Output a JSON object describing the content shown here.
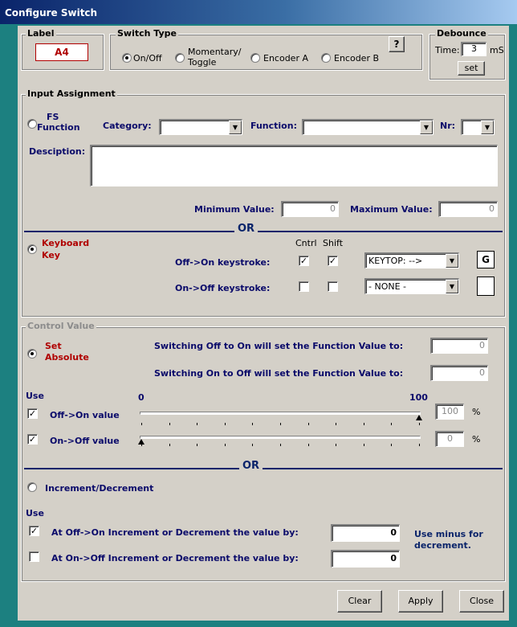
{
  "window": {
    "title": "Configure Switch"
  },
  "label_group": {
    "legend": "Label",
    "value": "A4"
  },
  "switch_type": {
    "legend": "Switch Type",
    "options": [
      "On/Off",
      "Momentary/",
      "Toggle",
      "Encoder A",
      "Encoder B"
    ],
    "selected": "On/Off",
    "help_label": "?"
  },
  "debounce": {
    "legend": "Debounce",
    "time_label": "Time:",
    "value": "3",
    "unit": "mS",
    "set_label": "set"
  },
  "input_assignment": {
    "legend": "Input Assignment",
    "fs_function_label_1": "FS",
    "fs_function_label_2": "Function",
    "category_label": "Category:",
    "category_value": "",
    "function_label": "Function:",
    "function_value": "",
    "nr_label": "Nr:",
    "nr_value": "",
    "description_label": "Desciption:",
    "description_value": "",
    "min_label": "Minimum Value:",
    "min_value": "0",
    "max_label": "Maximum Value:",
    "max_value": "0",
    "or_label": "OR",
    "keyboard_label_1": "Keyboard",
    "keyboard_label_2": "Key",
    "cntrl_label": "Cntrl",
    "shift_label": "Shift",
    "off_on_label": "Off->On keystroke:",
    "off_on_key": "KEYTOP: -->",
    "off_on_char": "G",
    "on_off_label": "On->Off keystroke:",
    "on_off_key": "- NONE -",
    "on_off_char": ""
  },
  "control_value": {
    "legend": "Control Value",
    "set_label_1": "Set",
    "set_label_2": "Absolute",
    "off_to_on_text": "Switching Off to On will set the Function Value to:",
    "off_to_on_value": "0",
    "on_to_off_text": "Switching On to Off will set the Function Value to:",
    "on_to_off_value": "0",
    "use_label": "Use",
    "scale_min": "0",
    "scale_max": "100",
    "off_on_value_label": "Off->On value",
    "off_on_value": "100",
    "off_on_level": 100,
    "on_off_value_label": "On->Off value",
    "on_off_value": "0",
    "on_off_level": 0,
    "percent": "%",
    "or_label": "OR",
    "incdec_label": "Increment/Decrement",
    "use_label_2": "Use",
    "inc_off_on_label": "At Off->On Increment or Decrement the value by:",
    "inc_off_on_value": "0",
    "inc_on_off_label": "At On->Off Increment or Decrement the value by:",
    "inc_on_off_value": "0",
    "hint": "Use minus for decrement."
  },
  "buttons": {
    "clear": "Clear",
    "apply": "Apply",
    "close": "Close"
  }
}
